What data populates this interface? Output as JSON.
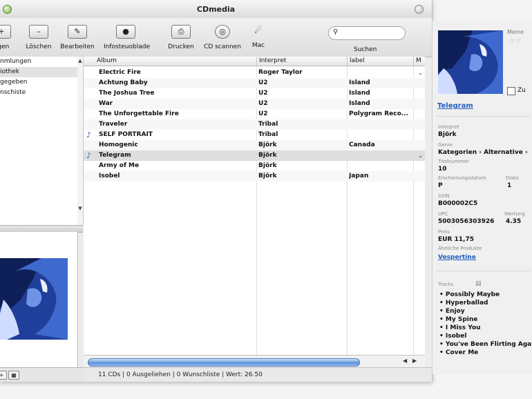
{
  "window": {
    "title": "CDmedia"
  },
  "toolbar": {
    "buttons": [
      {
        "label": "ügen",
        "icon": "add"
      },
      {
        "label": "Löschen",
        "icon": "minus"
      },
      {
        "label": "Bearbeiten",
        "icon": "edit"
      },
      {
        "label": "Infosteuoblade",
        "icon": "info"
      },
      {
        "label": "Drucken",
        "icon": "print"
      },
      {
        "label": "CD scannen",
        "icon": "cd"
      },
      {
        "label": "Mac",
        "icon": "mac"
      }
    ],
    "search_placeholder": "",
    "search_label": "Suchen"
  },
  "sidebar": {
    "items": [
      {
        "label": "nmlungen"
      },
      {
        "label": "iothek"
      },
      {
        "label": "gegeben"
      },
      {
        "label": "nschiste"
      }
    ]
  },
  "table": {
    "columns": [
      "Album",
      "Interpret",
      "label",
      "M"
    ],
    "rows": [
      {
        "note": false,
        "album": "Electric Fire",
        "artist": "Roger Taylor",
        "label": ""
      },
      {
        "note": false,
        "album": "Achtung Baby",
        "artist": "U2",
        "label": "Island"
      },
      {
        "note": false,
        "album": "The Joshua Tree",
        "artist": "U2",
        "label": "Island"
      },
      {
        "note": false,
        "album": "War",
        "artist": "U2",
        "label": "Island"
      },
      {
        "note": false,
        "album": "The Unforgettable Fire",
        "artist": "U2",
        "label": "Polygram Reco..."
      },
      {
        "note": false,
        "album": "Traveler",
        "artist": "Tribal",
        "label": ""
      },
      {
        "note": true,
        "album": "SELF PORTRAIT",
        "artist": "Tribal",
        "label": ""
      },
      {
        "note": false,
        "album": "Homogenic",
        "artist": "Björk",
        "label": "Canada"
      },
      {
        "note": true,
        "album": "Telegram",
        "artist": "Björk",
        "label": ""
      },
      {
        "note": false,
        "album": "Army of Me",
        "artist": "Björk",
        "label": ""
      },
      {
        "note": false,
        "album": "Isobel",
        "artist": "Björk",
        "label": "Japan"
      }
    ],
    "selected_row": 8
  },
  "status": {
    "text": "11 CDs | 0 Ausgeliehen | 0 Wunschliste | Wert: 26.50"
  },
  "info": {
    "meine_label": "Meine",
    "checkbox_label": "Zu",
    "title": "Telegram",
    "fields": [
      {
        "label": "Interpret",
        "value": "Björk"
      },
      {
        "label": "Genre",
        "value": "Kategorien › Alternative ›"
      },
      {
        "label": "Titelnummer",
        "value": "10"
      },
      {
        "label": "Erscheinungsdatum",
        "value": "P"
      },
      {
        "label": "Disks",
        "value": "1"
      },
      {
        "label": "ASIN",
        "value": "B000002C5"
      },
      {
        "label": "UPC",
        "value": "5003056303926"
      },
      {
        "label": "Wertung",
        "value": "4.35"
      },
      {
        "label": "Preis",
        "value": "EUR 11,75"
      },
      {
        "label": "Ähnliche Produkte",
        "value": "Vespertine"
      }
    ],
    "tracks_label": "Tracks",
    "tracks": [
      "Possibly Maybe",
      "Hyperballad",
      "Enjoy",
      "My Spine",
      "I Miss You",
      "Isobel",
      "You've Been Flirting Again",
      "Cover Me"
    ]
  }
}
